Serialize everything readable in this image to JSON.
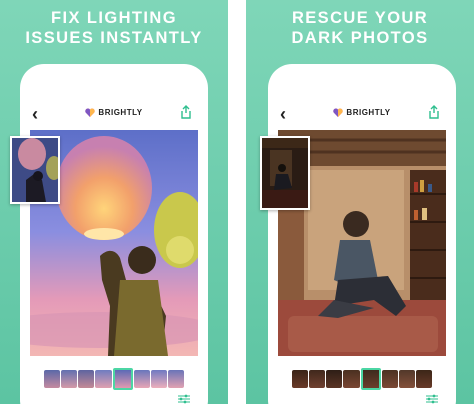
{
  "panels": [
    {
      "headline_line1": "FIX LIGHTING",
      "headline_line2": "ISSUES INSTANTLY"
    },
    {
      "headline_line1": "RESCUE YOUR",
      "headline_line2": "DARK PHOTOS"
    }
  ],
  "app": {
    "brand_name": "BRIGHTLY"
  },
  "colors": {
    "accent": "#4cd6a4",
    "background": "#66c9a8"
  }
}
